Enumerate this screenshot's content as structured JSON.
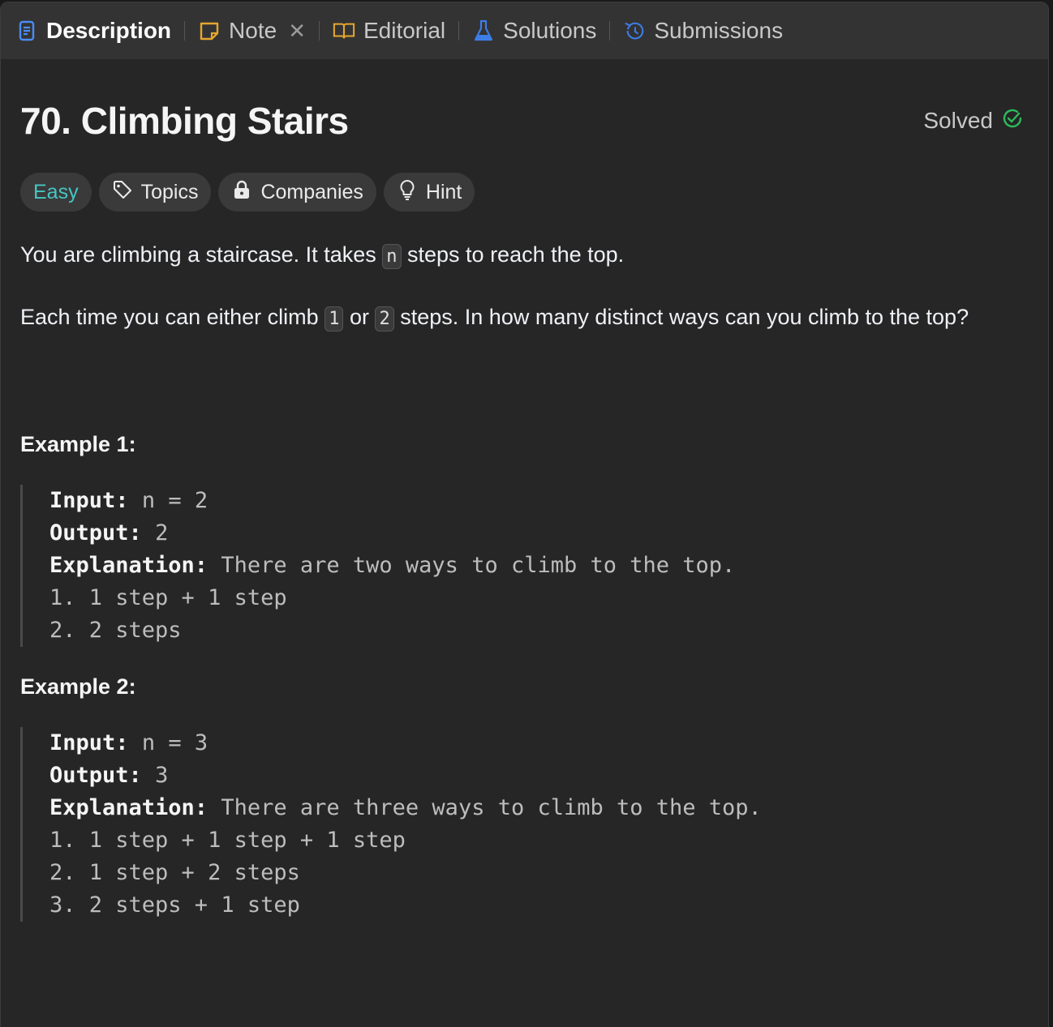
{
  "tabs": [
    {
      "label": "Description",
      "icon": "description-icon",
      "color": "#4a8cf7"
    },
    {
      "label": "Note",
      "icon": "note-icon",
      "color": "#e5a72e"
    },
    {
      "label": "Editorial",
      "icon": "book-icon",
      "color": "#e5a72e"
    },
    {
      "label": "Solutions",
      "icon": "flask-icon",
      "color": "#3d7de8"
    },
    {
      "label": "Submissions",
      "icon": "history-icon",
      "color": "#3d7de8"
    }
  ],
  "problem": {
    "title": "70. Climbing Stairs",
    "status": "Solved",
    "status_color": "#2cbb5d",
    "difficulty": "Easy",
    "difficulty_color": "#46c6c2",
    "chips": {
      "topics": "Topics",
      "companies": "Companies",
      "hint": "Hint"
    },
    "p1": {
      "before": "You are climbing a staircase. It takes",
      "code": "n",
      "after": "steps to reach the top."
    },
    "p2": {
      "before": "Each time you can either climb",
      "code1": "1",
      "mid": "or",
      "code2": "2",
      "after": "steps. In how many distinct ways can you climb to the top?"
    }
  },
  "examples": [
    {
      "title": "Example 1:",
      "input_label": "Input:",
      "input": "n = 2",
      "output_label": "Output:",
      "output": "2",
      "explanation_label": "Explanation:",
      "explanation": "There are two ways to climb to the top.",
      "steps": [
        "1. 1 step + 1 step",
        "2. 2 steps"
      ]
    },
    {
      "title": "Example 2:",
      "input_label": "Input:",
      "input": "n = 3",
      "output_label": "Output:",
      "output": "3",
      "explanation_label": "Explanation:",
      "explanation": "There are three ways to climb to the top.",
      "steps": [
        "1. 1 step + 1 step + 1 step",
        "2. 1 step + 2 steps",
        "3. 2 steps + 1 step"
      ]
    }
  ]
}
